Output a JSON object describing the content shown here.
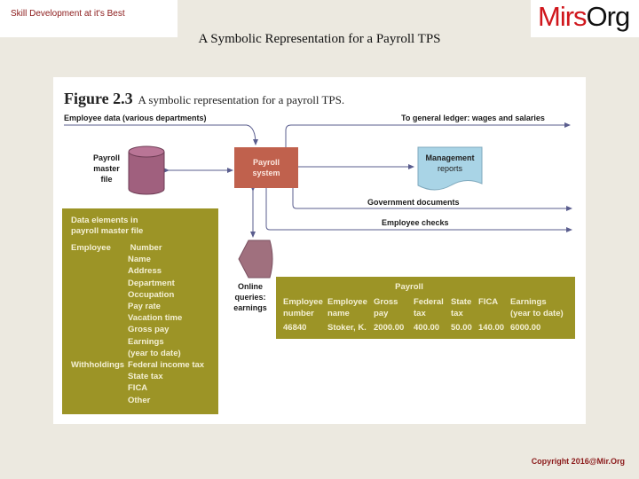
{
  "header": {
    "tagline": "Skill Development at it's Best",
    "title": "A Symbolic Representation for a Payroll TPS",
    "logo_red": "Mirs",
    "logo_dark": "Org"
  },
  "figure": {
    "number": "Figure 2.3",
    "caption": "A symbolic representation for a payroll TPS.",
    "employee_data_label": "Employee data (various departments)",
    "general_ledger_label": "To general ledger: wages and salaries",
    "master_file_label": [
      "Payroll",
      "master",
      "file"
    ],
    "payroll_system_label": [
      "Payroll",
      "system"
    ],
    "management_reports_label": [
      "Management",
      "reports"
    ],
    "government_documents_label": "Government documents",
    "employee_checks_label": "Employee checks",
    "online_queries_label": [
      "Online",
      "queries:",
      "earnings"
    ],
    "colors": {
      "payroll_system": "#c0614d",
      "master_file": "#a0607e",
      "management_reports": "#a9d4e6",
      "data_boxes": "#9c9426",
      "arrows": "#5a5d8e"
    },
    "data_elements": {
      "heading": [
        "Data elements in",
        "payroll master file"
      ],
      "groups": [
        {
          "name": "Employee",
          "items": [
            "Number",
            "Name",
            "Address",
            "Department",
            "Occupation",
            "Pay rate",
            "Vacation time",
            "Gross pay",
            "Earnings",
            "(year to date)"
          ]
        },
        {
          "name": "Withholdings",
          "items": [
            "Federal income tax",
            "State tax",
            "FICA",
            "Other"
          ]
        }
      ]
    },
    "payroll_table": {
      "title": "Payroll",
      "columns": [
        {
          "line1": "Employee",
          "line2": "number",
          "value": "46840"
        },
        {
          "line1": "Employee",
          "line2": "name",
          "value": "Stoker, K."
        },
        {
          "line1": "Gross",
          "line2": "pay",
          "value": "2000.00"
        },
        {
          "line1": "Federal",
          "line2": "tax",
          "value": "400.00"
        },
        {
          "line1": "State",
          "line2": "tax",
          "value": "50.00"
        },
        {
          "line1": "FICA",
          "line2": "",
          "value": "140.00"
        },
        {
          "line1": "Earnings",
          "line2": "(year to date)",
          "value": "6000.00"
        }
      ]
    }
  },
  "footer": {
    "copyright": "Copyright 2016@Mir.Org"
  }
}
